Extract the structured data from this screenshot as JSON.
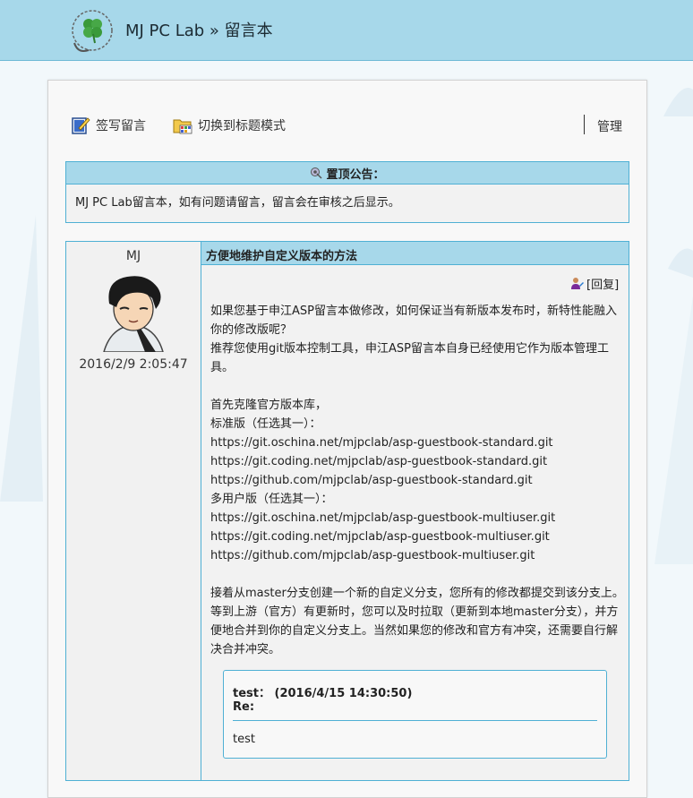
{
  "site": {
    "title": "MJ PC Lab » 留言本"
  },
  "toolbar": {
    "write_label": "签写留言",
    "switch_label": "切换到标题模式",
    "admin_label": "管理"
  },
  "notice": {
    "heading": "置顶公告：",
    "body": "MJ PC Lab留言本，如有问题请留言，留言会在审核之后显示。"
  },
  "post": {
    "author": "MJ",
    "date": "2016/2/9 2:05:47",
    "title": "方便地维护自定义版本的方法",
    "reply_label": "[回复]",
    "content": "如果您基于申江ASP留言本做修改，如何保证当有新版本发布时，新特性能融入你的修改版呢？\n推荐您使用git版本控制工具，申江ASP留言本自身已经使用它作为版本管理工具。\n\n首先克隆官方版本库，\n标准版（任选其一）：\nhttps://git.oschina.net/mjpclab/asp-guestbook-standard.git\nhttps://git.coding.net/mjpclab/asp-guestbook-standard.git\nhttps://github.com/mjpclab/asp-guestbook-standard.git\n多用户版（任选其一）：\nhttps://git.oschina.net/mjpclab/asp-guestbook-multiuser.git\nhttps://git.coding.net/mjpclab/asp-guestbook-multiuser.git\nhttps://github.com/mjpclab/asp-guestbook-multiuser.git\n\n接着从master分支创建一个新的自定义分支，您所有的修改都提交到该分支上。等到上游（官方）有更新时，您可以及时拉取（更新到本地master分支），并方便地合并到你的自定义分支上。当然如果您的修改和官方有冲突，还需要自行解决合并冲突。",
    "admin_reply": {
      "user_line": "test：  (2016/4/15 14:30:50)",
      "re_label": "Re:",
      "text": "test"
    }
  },
  "colors": {
    "header_bg": "#a7d8ea",
    "border": "#4fb0d4",
    "page_bg": "#f2f8fb"
  }
}
